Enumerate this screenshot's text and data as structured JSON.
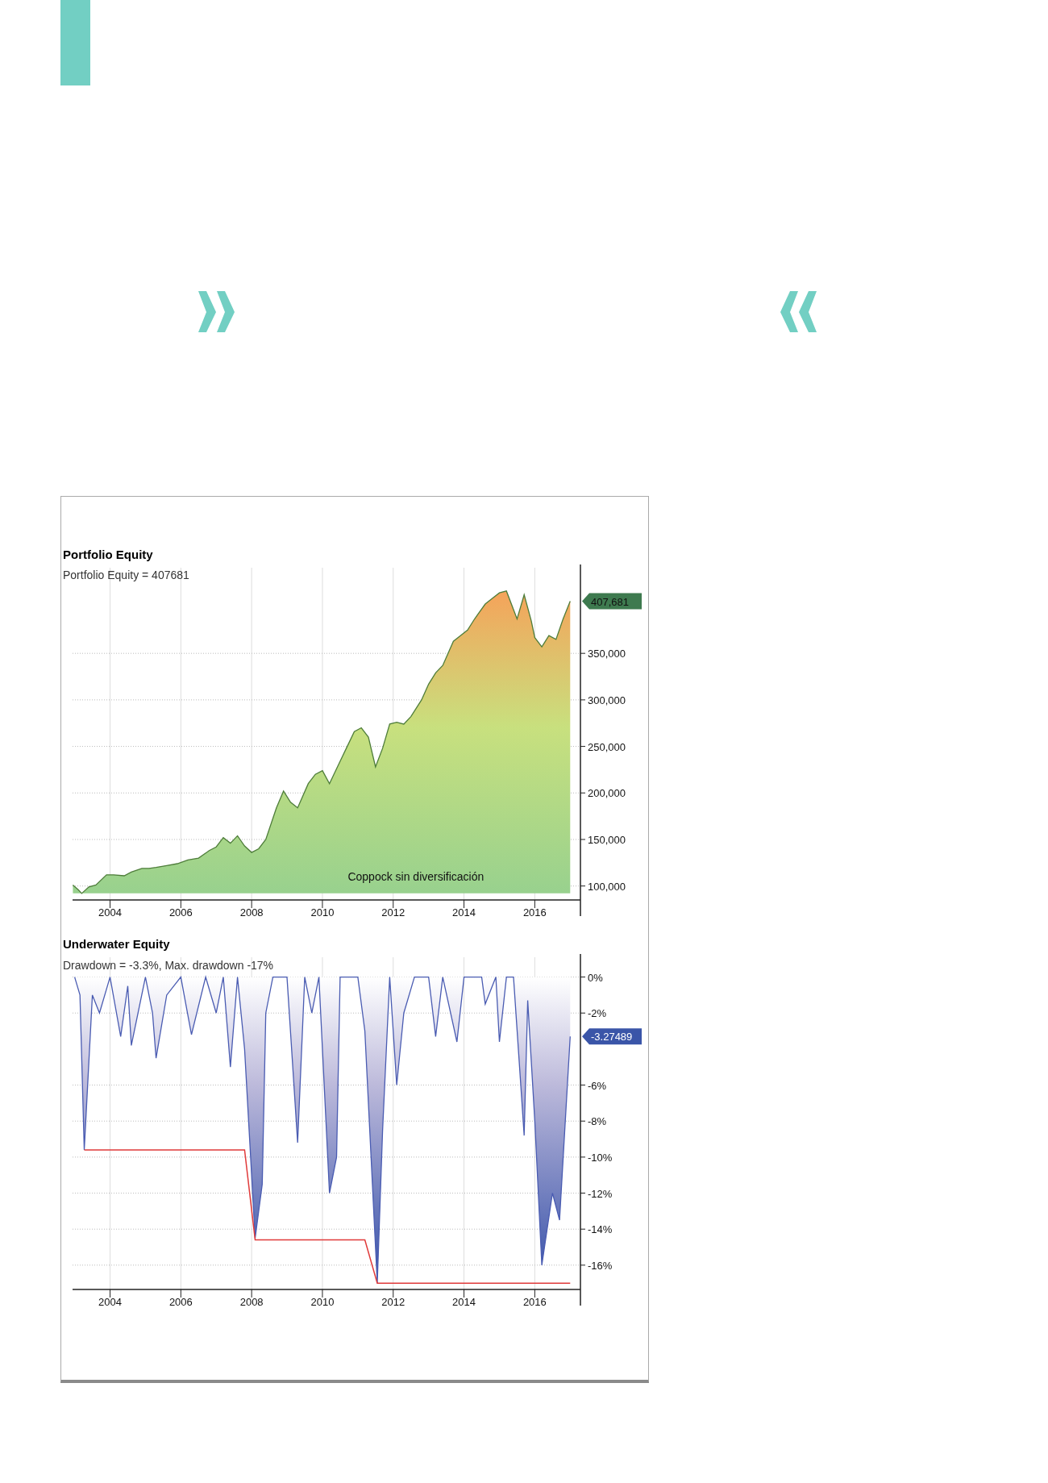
{
  "charts": [
    {
      "kind": "equity",
      "subtitle": "Portfolio Equity = 407681",
      "badge": "407,681",
      "chart_data": {
        "type": "area",
        "title": "Portfolio Equity",
        "x": [
          2002.95,
          2003.1,
          2003.2,
          2003.4,
          2003.6,
          2003.9,
          2004.1,
          2004.4,
          2004.6,
          2004.9,
          2005.1,
          2005.3,
          2005.6,
          2005.9,
          2006.2,
          2006.5,
          2006.8,
          2007.0,
          2007.2,
          2007.4,
          2007.6,
          2007.8,
          2008.0,
          2008.2,
          2008.4,
          2008.7,
          2008.9,
          2009.1,
          2009.3,
          2009.6,
          2009.8,
          2010.0,
          2010.2,
          2010.3,
          2010.5,
          2010.7,
          2010.9,
          2011.1,
          2011.3,
          2011.5,
          2011.7,
          2011.9,
          2012.1,
          2012.3,
          2012.5,
          2012.8,
          2013.0,
          2013.2,
          2013.4,
          2013.7,
          2013.9,
          2014.1,
          2014.3,
          2014.6,
          2014.8,
          2015.0,
          2015.2,
          2015.5,
          2015.7,
          2015.9,
          2016.0,
          2016.2,
          2016.4,
          2016.6,
          2016.8,
          2017.0
        ],
        "series": [
          {
            "color": "#4e7d3a",
            "values": [
              101000,
              96000,
              92000,
              99000,
              101000,
              112000,
              112000,
              111000,
              115000,
              119000,
              119000,
              120000,
              122000,
              124000,
              128000,
              130000,
              138000,
              142000,
              152000,
              146000,
              154000,
              143000,
              136000,
              140000,
              150000,
              184000,
              202000,
              190000,
              184000,
              210000,
              220000,
              224000,
              210000,
              218000,
              234000,
              250000,
              266000,
              270000,
              260000,
              228000,
              248000,
              274000,
              276000,
              274000,
              282000,
              300000,
              317000,
              329000,
              337000,
              363000,
              369000,
              375000,
              387000,
              403000,
              409000,
              415000,
              417000,
              387000,
              413000,
              385000,
              367000,
              357000,
              369000,
              365000,
              387000,
              406000
            ]
          }
        ],
        "xlim": [
          2002.94,
          2017.29
        ],
        "ylim": [
          85000,
          442000
        ],
        "xticks": [
          {
            "value": 2004,
            "label": "2004"
          },
          {
            "value": 2006,
            "label": "2006"
          },
          {
            "value": 2008,
            "label": "2008"
          },
          {
            "value": 2010,
            "label": "2010"
          },
          {
            "value": 2012,
            "label": "2012"
          },
          {
            "value": 2014,
            "label": "2014"
          },
          {
            "value": 2016,
            "label": "2016"
          }
        ],
        "yticks": [
          {
            "value": 100000,
            "label": "100,000"
          },
          {
            "value": 150000,
            "label": "150,000"
          },
          {
            "value": 200000,
            "label": "200,000"
          },
          {
            "value": 250000,
            "label": "250,000"
          },
          {
            "value": 300000,
            "label": "300,000"
          },
          {
            "value": 350000,
            "label": "350,000"
          }
        ],
        "annotations": [
          "Coppock sin diversificación"
        ],
        "grid": true
      }
    },
    {
      "kind": "underwater",
      "subtitle": "Drawdown = -3.3%, Max. drawdown -17%",
      "badge": "-3.27489",
      "chart_data": {
        "type": "area",
        "title": "Underwater Equity",
        "x": [
          2003.0,
          2003.15,
          2003.27,
          2003.5,
          2003.7,
          2004.0,
          2004.3,
          2004.5,
          2004.6,
          2005.0,
          2005.2,
          2005.3,
          2005.6,
          2006.0,
          2006.3,
          2006.7,
          2007.0,
          2007.2,
          2007.4,
          2007.6,
          2007.8,
          2008.1,
          2008.3,
          2008.4,
          2008.6,
          2009.0,
          2009.3,
          2009.5,
          2009.7,
          2009.9,
          2010.2,
          2010.4,
          2010.5,
          2011.0,
          2011.2,
          2011.55,
          2011.7,
          2011.9,
          2012.1,
          2012.3,
          2012.6,
          2013.0,
          2013.2,
          2013.4,
          2013.8,
          2014.0,
          2014.5,
          2014.6,
          2014.9,
          2015.0,
          2015.2,
          2015.4,
          2015.7,
          2015.8,
          2016.0,
          2016.2,
          2016.5,
          2016.7,
          2017.0
        ],
        "series": [
          {
            "color": "#4a5cb2",
            "values": [
              0,
              -1,
              -9.6,
              -1,
              -2,
              0,
              -3.3,
              -0.5,
              -3.8,
              0,
              -2,
              -4.5,
              -1,
              0,
              -3.2,
              0,
              -2,
              0,
              -5,
              0,
              -4,
              -14.5,
              -11.5,
              -2,
              0,
              0,
              -9.2,
              0,
              -2,
              0,
              -12,
              -10,
              0,
              0,
              -3,
              -17,
              -8.5,
              0,
              -6,
              -2,
              0,
              0,
              -3.3,
              0,
              -3.6,
              0,
              0,
              -1.5,
              0,
              -3.6,
              0,
              0,
              -8.8,
              -1.3,
              -8,
              -16,
              -12,
              -13.5,
              -3.3
            ]
          },
          {
            "type": "line",
            "color": "#e03a3a",
            "values": [
              null,
              null,
              -9.6,
              -9.6,
              -9.6,
              -9.6,
              -9.6,
              -9.6,
              -9.6,
              -9.6,
              -9.6,
              -9.6,
              -9.6,
              -9.6,
              -9.6,
              -9.6,
              -9.6,
              -9.6,
              -9.6,
              -9.6,
              -9.6,
              -14.6,
              -14.6,
              -14.6,
              -14.6,
              -14.6,
              -14.6,
              -14.6,
              -14.6,
              -14.6,
              -14.6,
              -14.6,
              -14.6,
              -14.6,
              -14.6,
              -17,
              -17,
              -17,
              -17,
              -17,
              -17,
              -17,
              -17,
              -17,
              -17,
              -17,
              -17,
              -17,
              -17,
              -17,
              -17,
              -17,
              -17,
              -17,
              -17,
              -17,
              -17,
              -17,
              -17
            ]
          }
        ],
        "xlim": [
          2002.94,
          2017.29
        ],
        "ylim": [
          -17.35,
          1.1
        ],
        "xticks": [
          {
            "value": 2004,
            "label": "2004"
          },
          {
            "value": 2006,
            "label": "2006"
          },
          {
            "value": 2008,
            "label": "2008"
          },
          {
            "value": 2010,
            "label": "2010"
          },
          {
            "value": 2012,
            "label": "2012"
          },
          {
            "value": 2014,
            "label": "2014"
          },
          {
            "value": 2016,
            "label": "2016"
          }
        ],
        "yticks": [
          {
            "value": 0,
            "label": "0%"
          },
          {
            "value": -2,
            "label": "-2%"
          },
          {
            "value": -6,
            "label": "-6%"
          },
          {
            "value": -8,
            "label": "-8%"
          },
          {
            "value": -10,
            "label": "-10%"
          },
          {
            "value": -12,
            "label": "-12%"
          },
          {
            "value": -14,
            "label": "-14%"
          },
          {
            "value": -16,
            "label": "-16%"
          }
        ],
        "grid": true
      }
    }
  ]
}
